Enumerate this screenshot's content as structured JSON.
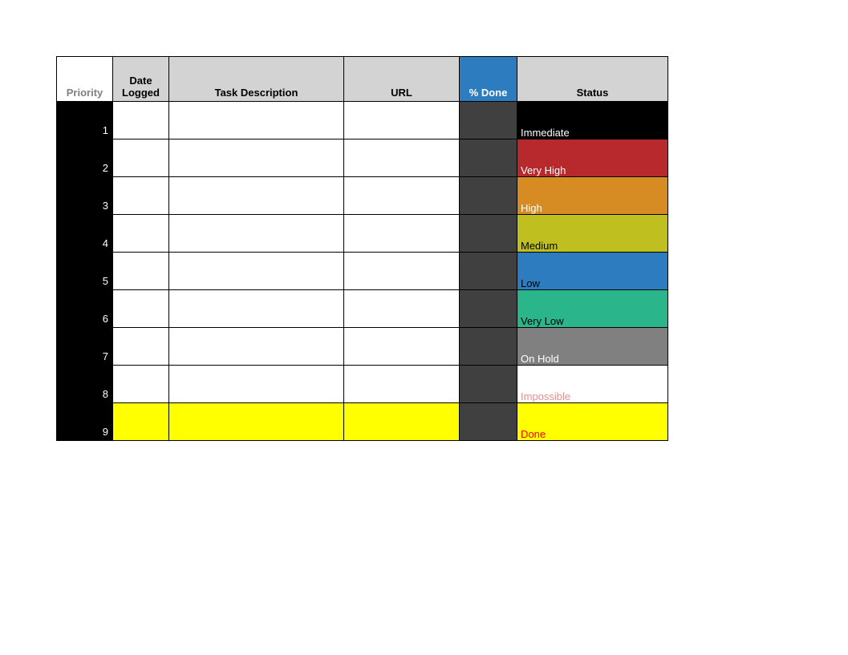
{
  "header": {
    "priority": "Priority",
    "date_logged": "Date Logged",
    "task_description": "Task Description",
    "url": "URL",
    "pct_done": "% Done",
    "status": "Status"
  },
  "rows": [
    {
      "priority": "1",
      "status_label": "Immediate",
      "status_bg": "#000000",
      "status_fg": "#ffffff",
      "row_bg_override": null
    },
    {
      "priority": "2",
      "status_label": "Very High",
      "status_bg": "#b8292e",
      "status_fg": "#ffffff",
      "row_bg_override": null
    },
    {
      "priority": "3",
      "status_label": "High",
      "status_bg": "#d68b23",
      "status_fg": "#ffffff",
      "row_bg_override": null
    },
    {
      "priority": "4",
      "status_label": "Medium",
      "status_bg": "#bfbf1f",
      "status_fg": "#000000",
      "row_bg_override": null
    },
    {
      "priority": "5",
      "status_label": "Low",
      "status_bg": "#2d7cc0",
      "status_fg": "#000000",
      "row_bg_override": null
    },
    {
      "priority": "6",
      "status_label": "Very Low",
      "status_bg": "#2bb58a",
      "status_fg": "#000000",
      "row_bg_override": null
    },
    {
      "priority": "7",
      "status_label": "On Hold",
      "status_bg": "#808080",
      "status_fg": "#ffffff",
      "row_bg_override": null
    },
    {
      "priority": "8",
      "status_label": "Impossible",
      "status_bg": "#ffffff",
      "status_fg": "#e78f8d",
      "row_bg_override": null
    },
    {
      "priority": "9",
      "status_label": "Done",
      "status_bg": "#ffff00",
      "status_fg": "#ff0000",
      "row_bg_override": "#ffff00"
    }
  ]
}
